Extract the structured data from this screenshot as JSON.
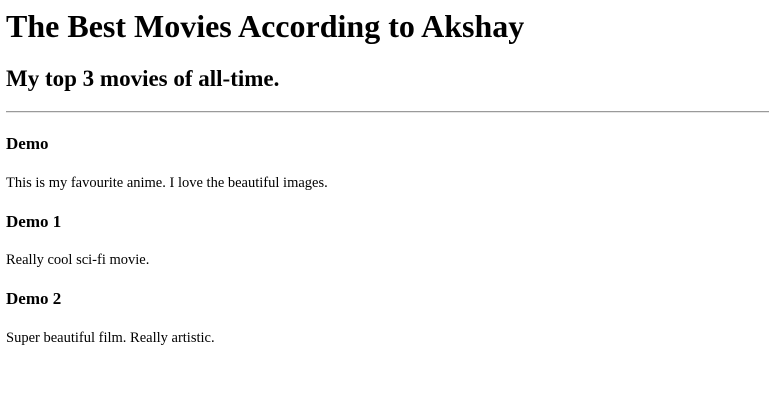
{
  "header": {
    "title": "The Best Movies According to Akshay",
    "subtitle": "My top 3 movies of all-time."
  },
  "movies": [
    {
      "title": "Demo",
      "description": "This is my favourite anime. I love the beautiful images."
    },
    {
      "title": "Demo 1",
      "description": "Really cool sci-fi movie."
    },
    {
      "title": "Demo 2",
      "description": "Super beautiful film. Really artistic."
    }
  ]
}
